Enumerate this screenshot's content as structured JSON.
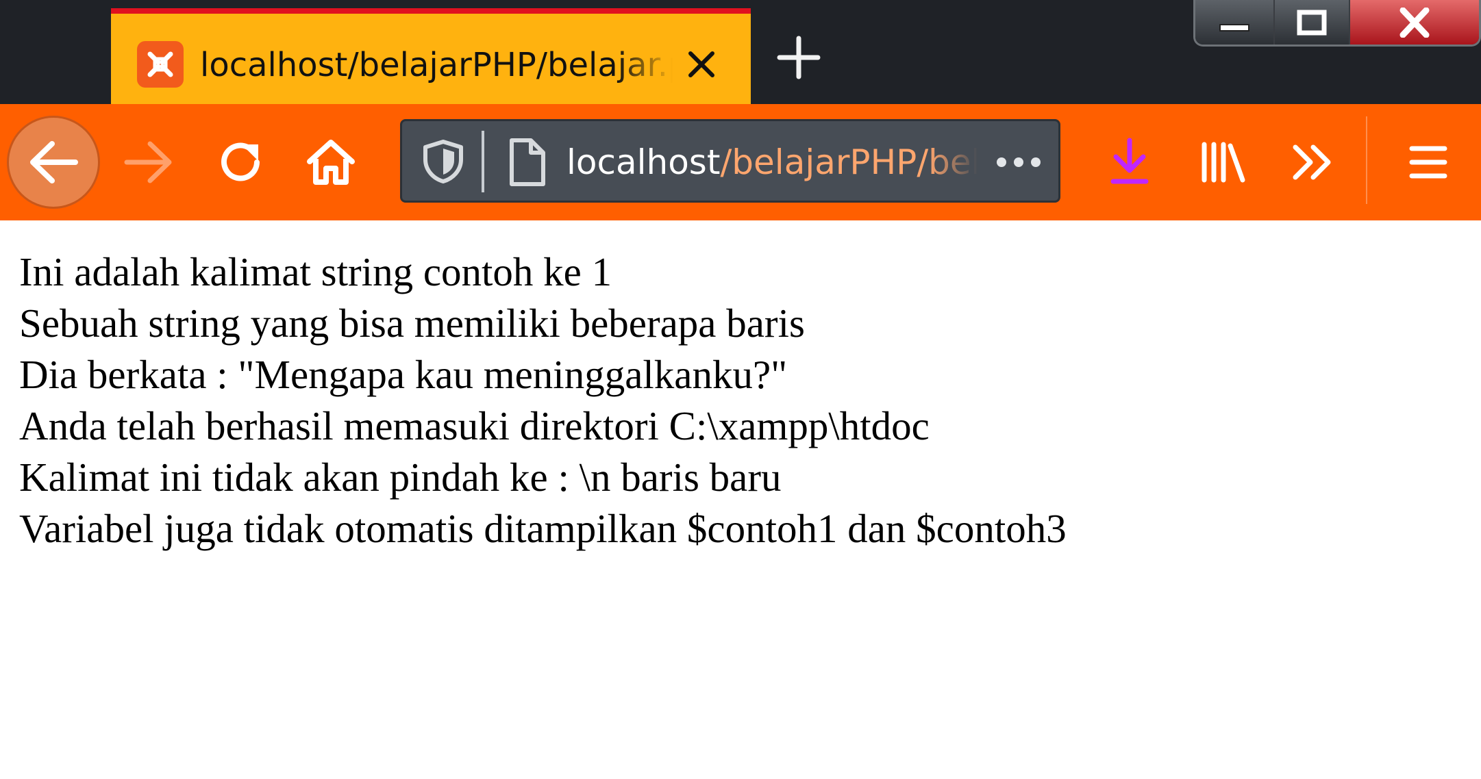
{
  "browser": {
    "tab": {
      "title": "localhost/belajarPHP/belajar.php",
      "favicon": "xampp-icon"
    },
    "new_tab_icon": "plus-icon",
    "window_controls": [
      "minimize-icon",
      "maximize-icon",
      "close-icon"
    ],
    "toolbar": {
      "back_icon": "arrow-left-icon",
      "forward_icon": "arrow-right-icon",
      "reload_icon": "reload-icon",
      "home_icon": "home-icon",
      "downloads_icon": "download-icon",
      "library_icon": "library-icon",
      "overflow_icon": "chevron-double-right-icon",
      "menu_icon": "hamburger-menu-icon"
    },
    "urlbar": {
      "host": "localhost",
      "path": "/belajarPHP/belajar.php",
      "shield_icon": "shield-icon",
      "page_icon": "page-icon",
      "more_icon": "ellipsis-icon"
    },
    "colors": {
      "tab_active": "#ffb20f",
      "tab_accent": "#e0111f",
      "toolbar": "#ff5f00",
      "urlbar": "#474d55",
      "download_accent": "#c026ff"
    }
  },
  "page": {
    "lines": [
      "Ini adalah kalimat string contoh ke 1",
      "Sebuah string yang bisa memiliki beberapa baris",
      "Dia berkata : \"Mengapa kau meninggalkanku?\"",
      "Anda telah berhasil memasuki direktori C:\\xampp\\htdoc",
      "Kalimat ini tidak akan pindah ke : \\n baris baru",
      "Variabel juga tidak otomatis ditampilkan $contoh1 dan $contoh3"
    ]
  }
}
